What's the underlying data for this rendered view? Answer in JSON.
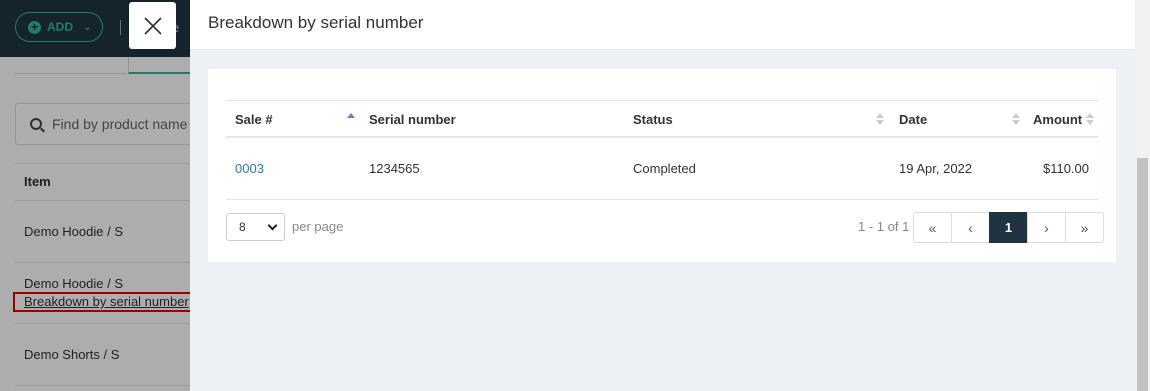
{
  "background": {
    "add_button": {
      "label": "ADD"
    },
    "top_partial_text": "e",
    "search": {
      "placeholder": "Find by product name"
    },
    "column_header": "Item",
    "rows": [
      {
        "label": "Demo Hoodie / S"
      },
      {
        "label": "Demo Hoodie / S"
      },
      {
        "label": "Demo Shorts / S"
      }
    ],
    "highlighted_link": "Breakdown by serial number"
  },
  "modal": {
    "title": "Breakdown by serial number",
    "table": {
      "columns": [
        {
          "label": "Sale #",
          "sort": "asc"
        },
        {
          "label": "Serial number",
          "sort": "none"
        },
        {
          "label": "Status",
          "sort": "both"
        },
        {
          "label": "Date",
          "sort": "both"
        },
        {
          "label": "Amount",
          "sort": "both"
        }
      ],
      "rows": [
        {
          "sale": "0003",
          "serial": "1234565",
          "status": "Completed",
          "date": "19 Apr, 2022",
          "amount": "$110.00"
        }
      ]
    },
    "pagination": {
      "per_page_value": "8",
      "per_page_label": "per page",
      "range_text": "1 - 1 of 1",
      "buttons": {
        "first": "«",
        "prev": "‹",
        "current": "1",
        "next": "›",
        "last": "»"
      }
    }
  },
  "colors": {
    "topbar": "#1f3440",
    "accent": "#2fb5a0",
    "link": "#2f79c4",
    "highlight": "#e00000",
    "sort_active": "#6b7bd6"
  }
}
